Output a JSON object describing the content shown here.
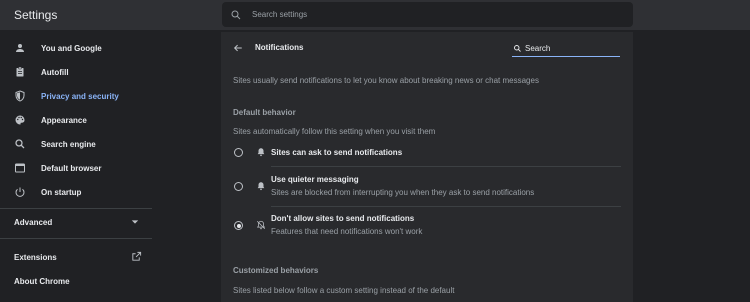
{
  "app": {
    "title": "Settings"
  },
  "search": {
    "placeholder": "Search settings"
  },
  "sidebar": {
    "items": [
      {
        "label": "You and Google",
        "icon": "person-icon"
      },
      {
        "label": "Autofill",
        "icon": "clipboard-icon"
      },
      {
        "label": "Privacy and security",
        "icon": "shield-icon",
        "active": true
      },
      {
        "label": "Appearance",
        "icon": "palette-icon"
      },
      {
        "label": "Search engine",
        "icon": "search-icon"
      },
      {
        "label": "Default browser",
        "icon": "browser-window-icon"
      },
      {
        "label": "On startup",
        "icon": "power-icon"
      }
    ],
    "advanced_label": "Advanced",
    "extensions_label": "Extensions",
    "about_label": "About Chrome"
  },
  "notifications": {
    "title": "Notifications",
    "search_placeholder": "Search",
    "intro": "Sites usually send notifications to let you know about breaking news or chat messages",
    "default_behavior": {
      "heading": "Default behavior",
      "description": "Sites automatically follow this setting when you visit them",
      "options": [
        {
          "label": "Sites can ask to send notifications",
          "sublabel": "",
          "icon": "bell-icon",
          "selected": false
        },
        {
          "label": "Use quieter messaging",
          "sublabel": "Sites are blocked from interrupting you when they ask to send notifications",
          "icon": "bell-icon",
          "selected": false
        },
        {
          "label": "Don't allow sites to send notifications",
          "sublabel": "Features that need notifications won't work",
          "icon": "bell-off-icon",
          "selected": true
        }
      ]
    },
    "customized_behaviors": {
      "heading": "Customized behaviors",
      "description": "Sites listed below follow a custom setting instead of the default"
    }
  },
  "colors": {
    "background": "#202124",
    "topbar": "#2f3034",
    "panel": "#292a2d",
    "text": "#e8eaed",
    "secondary_text": "#9aa0a6",
    "accent": "#8ab4f8"
  }
}
